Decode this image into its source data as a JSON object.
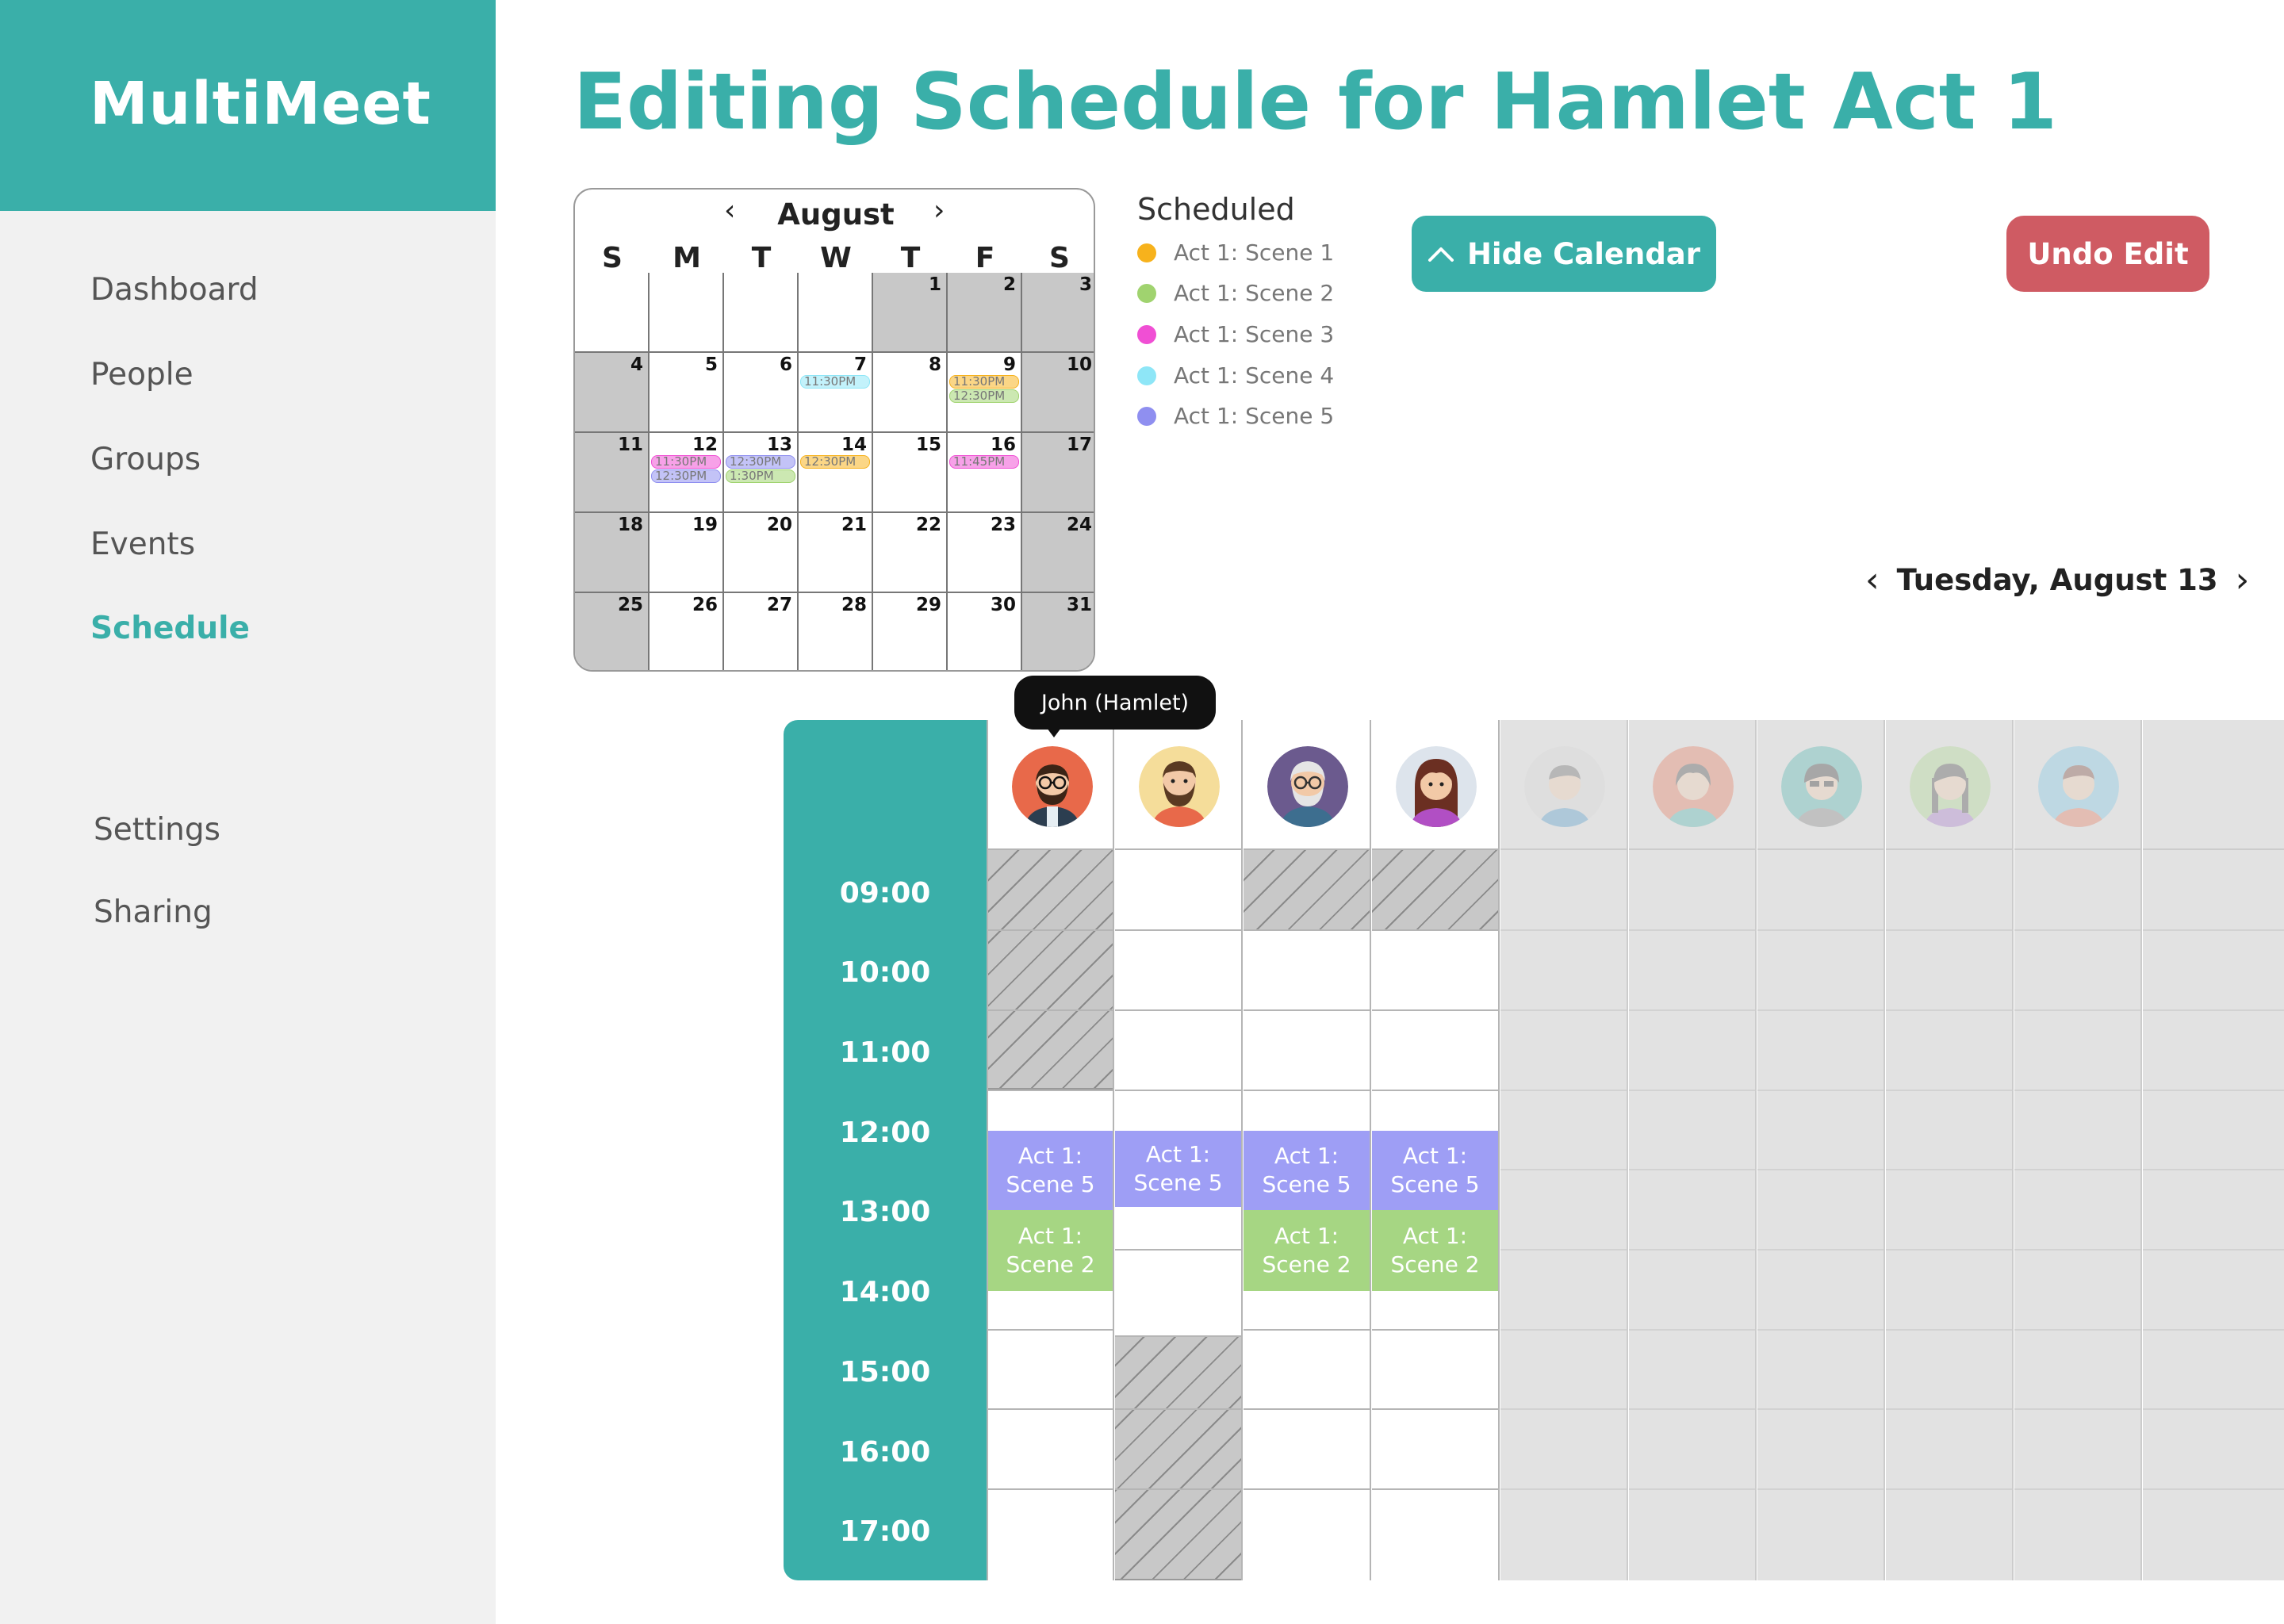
{
  "app": {
    "name": "MultiMeet"
  },
  "nav": {
    "items": [
      "Dashboard",
      "People",
      "Groups",
      "Events",
      "Schedule"
    ],
    "active": "Schedule",
    "bottom_items": [
      "Settings",
      "Sharing"
    ]
  },
  "page": {
    "title": "Editing Schedule for Hamlet Act 1"
  },
  "calendar": {
    "month": "August",
    "prev_icon": "chevron-left-icon",
    "next_icon": "chevron-right-icon",
    "weekdays": [
      "S",
      "M",
      "T",
      "W",
      "T",
      "F",
      "S"
    ],
    "days": [
      "",
      "",
      "",
      "",
      "1",
      "2",
      "3",
      "4",
      "5",
      "6",
      "7",
      "8",
      "9",
      "10",
      "11",
      "12",
      "13",
      "14",
      "15",
      "16",
      "17",
      "18",
      "19",
      "20",
      "21",
      "22",
      "23",
      "24",
      "25",
      "26",
      "27",
      "28",
      "29",
      "30",
      "31"
    ],
    "shaded_cells": [
      4,
      5,
      6,
      7,
      13,
      14,
      20,
      21,
      27,
      28,
      34
    ],
    "events": [
      {
        "day": "7",
        "time": "11:30PM",
        "color": "#8ee6f7"
      },
      {
        "day": "9",
        "time": "11:30PM",
        "color": "#f7b21c"
      },
      {
        "day": "9",
        "time": "12:30PM",
        "color": "#a0d36f"
      },
      {
        "day": "12",
        "time": "11:30PM",
        "color": "#f04fd4"
      },
      {
        "day": "12",
        "time": "12:30PM",
        "color": "#8f8ff0"
      },
      {
        "day": "13",
        "time": "12:30PM",
        "color": "#8f8ff0"
      },
      {
        "day": "13",
        "time": "1:30PM",
        "color": "#a0d36f"
      },
      {
        "day": "14",
        "time": "12:30PM",
        "color": "#f7b21c"
      },
      {
        "day": "16",
        "time": "11:45PM",
        "color": "#f04fd4"
      }
    ]
  },
  "legend": {
    "title": "Scheduled",
    "items": [
      {
        "label": "Act 1: Scene 1",
        "color": "#f7b21c"
      },
      {
        "label": "Act 1: Scene 2",
        "color": "#a0d36f"
      },
      {
        "label": "Act 1: Scene 3",
        "color": "#f04fd4"
      },
      {
        "label": "Act 1: Scene 4",
        "color": "#8ee6f7"
      },
      {
        "label": "Act 1: Scene 5",
        "color": "#8f8ff0"
      }
    ]
  },
  "buttons": {
    "hide_calendar": "Hide Calendar",
    "hide_calendar_icon": "chevron-up-icon",
    "undo_edit": "Undo Edit"
  },
  "date_nav": {
    "label": "Tuesday, August 13",
    "prev_icon": "chevron-left-icon",
    "next_icon": "chevron-right-icon"
  },
  "schedule": {
    "times": [
      "09:00",
      "10:00",
      "11:00",
      "12:00",
      "13:00",
      "14:00",
      "15:00",
      "16:00",
      "17:00"
    ],
    "tooltip": "John (Hamlet)",
    "people": [
      {
        "avatar": "man-glasses-beard-avatar",
        "active": true
      },
      {
        "avatar": "man-beard-avatar",
        "active": true
      },
      {
        "avatar": "old-man-glasses-avatar",
        "active": true
      },
      {
        "avatar": "woman-brown-hair-avatar",
        "active": true
      },
      {
        "avatar": "person-avatar",
        "active": false
      },
      {
        "avatar": "person-avatar",
        "active": false
      },
      {
        "avatar": "person-sunglasses-avatar",
        "active": false
      },
      {
        "avatar": "woman-braids-avatar",
        "active": false
      },
      {
        "avatar": "man-avatar",
        "active": false
      },
      {
        "avatar": "empty-slot",
        "active": false
      }
    ],
    "events": [
      {
        "person": 0,
        "label": "Act 1: Scene 5",
        "color": "#9e9ef5"
      },
      {
        "person": 1,
        "label": "Act 1: Scene 5",
        "color": "#9e9ef5"
      },
      {
        "person": 2,
        "label": "Act 1: Scene 5",
        "color": "#9e9ef5"
      },
      {
        "person": 3,
        "label": "Act 1: Scene 5",
        "color": "#9e9ef5"
      },
      {
        "person": 0,
        "label": "Act 1: Scene 2",
        "color": "#a6d683"
      },
      {
        "person": 2,
        "label": "Act 1: Scene 2",
        "color": "#a6d683"
      },
      {
        "person": 3,
        "label": "Act 1: Scene 2",
        "color": "#a6d683"
      }
    ]
  }
}
